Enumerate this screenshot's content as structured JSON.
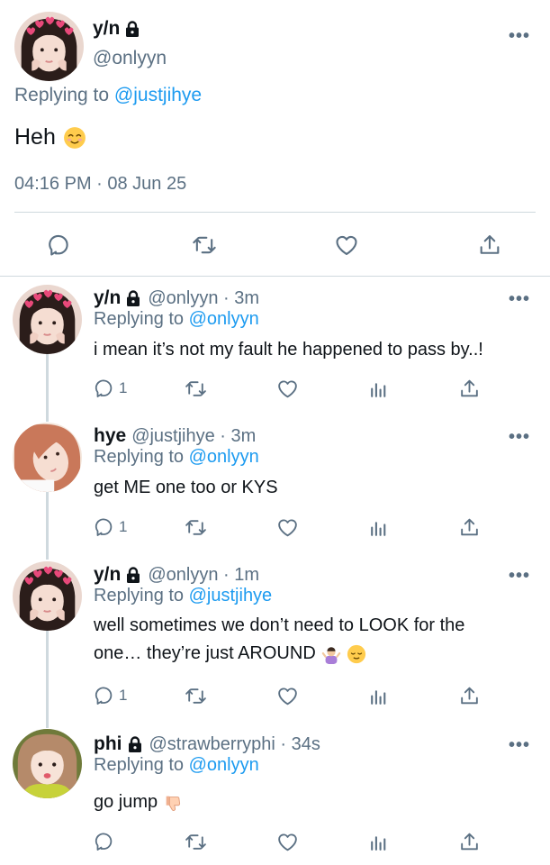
{
  "main_tweet": {
    "name": "y/n",
    "handle": "@onlyyn",
    "replying_prefix": "Replying to",
    "replying_to": "@justjihye",
    "text": "Heh",
    "timestamp": "04:16 PM · 08 Jun 25"
  },
  "replies": [
    {
      "name": "y/n",
      "handle": "@onlyyn · 3m",
      "replying_prefix": "Replying to",
      "replying_to": "@onlyyn",
      "text": "i mean it’s not my fault he happened to pass by..!",
      "reply_count": "1"
    },
    {
      "name": "hye",
      "handle": "@justjihye · 3m",
      "replying_prefix": "Replying to",
      "replying_to": "@onlyyn",
      "text": "get ME one too or KYS",
      "reply_count": "1"
    },
    {
      "name": "y/n",
      "handle": "@onlyyn · 1m",
      "replying_prefix": "Replying to",
      "replying_to": "@justjihye",
      "text_line1": "well sometimes we don’t need to LOOK for the",
      "text_line2": "one… they’re just AROUND",
      "reply_count": "1"
    },
    {
      "name": "phi",
      "handle": "@strawberryphi · 34s",
      "replying_prefix": "Replying to",
      "replying_to": "@onlyyn",
      "text": "go jump"
    }
  ],
  "icons": {
    "more": "more-horizontal-icon",
    "lock": "lock-icon",
    "reply": "reply-icon",
    "retweet": "retweet-icon",
    "like": "heart-icon",
    "views": "views-icon",
    "share": "share-icon"
  },
  "colors": {
    "accent": "#1d9bf0",
    "muted": "#5b7083",
    "text": "#0f1419",
    "divider": "#cfd9de"
  }
}
